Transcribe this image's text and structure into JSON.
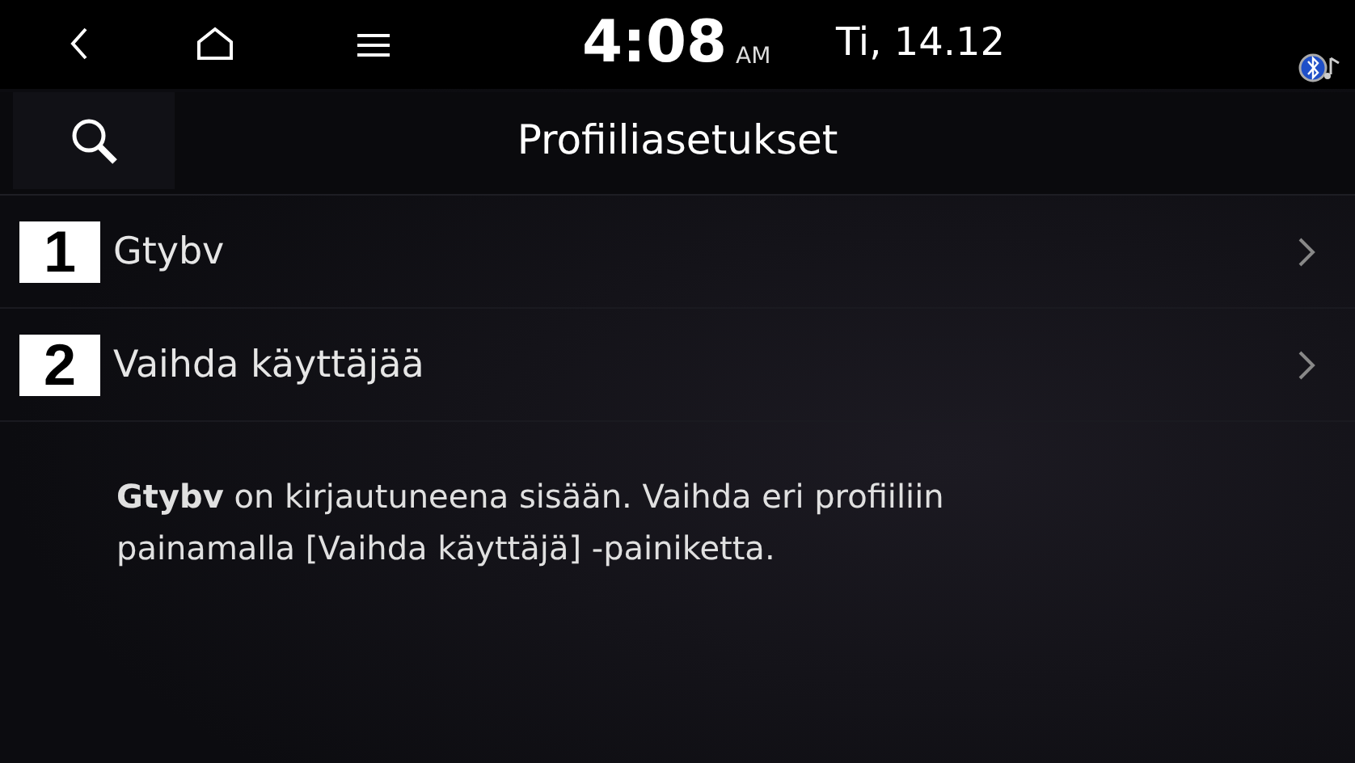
{
  "status_bar": {
    "time": "4:08",
    "meridiem": "AM",
    "date": "Ti, 14.12"
  },
  "header": {
    "title": "Profiiliasetukset"
  },
  "items": [
    {
      "badge": "1",
      "label": "Gtybv"
    },
    {
      "badge": "2",
      "label": "Vaihda käyttäjää"
    }
  ],
  "description": "**Gtybv** on kirjautuneena sisään. Vaihda eri profiiliin painamalla [Vaihda käyttäjä] -painiketta."
}
